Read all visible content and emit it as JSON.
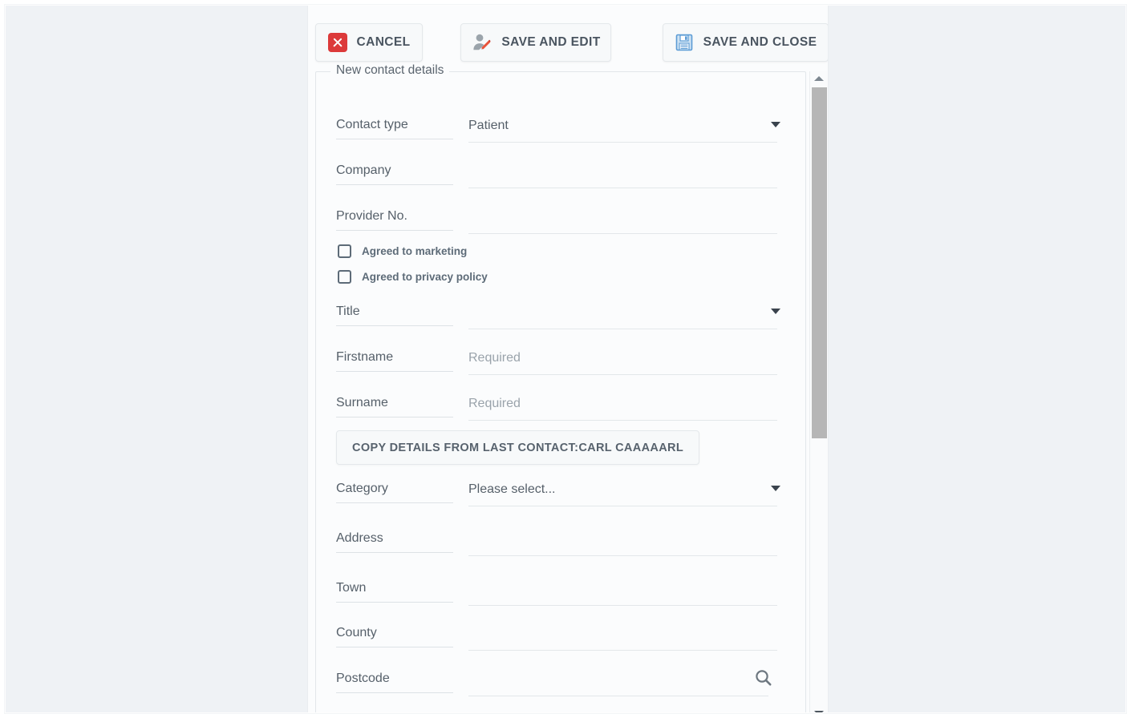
{
  "toolbar": {
    "cancel_label": "CANCEL",
    "save_and_edit_label": "SAVE AND EDIT",
    "save_and_close_label": "SAVE AND CLOSE"
  },
  "form": {
    "legend": "New contact details",
    "fields": [
      {
        "label": "Contact type",
        "value": "Patient",
        "placeholder": "",
        "type": "select"
      },
      {
        "label": "Company",
        "value": "",
        "placeholder": "",
        "type": "text"
      },
      {
        "label": "Provider No.",
        "value": "",
        "placeholder": "",
        "type": "text"
      },
      {
        "label": "Title",
        "value": "",
        "placeholder": "",
        "type": "select"
      },
      {
        "label": "Firstname",
        "value": "",
        "placeholder": "Required",
        "type": "text"
      },
      {
        "label": "Surname",
        "value": "",
        "placeholder": "Required",
        "type": "text"
      },
      {
        "label": "Category",
        "value": "Please select...",
        "placeholder": "",
        "type": "select"
      },
      {
        "label": "Address",
        "value": "",
        "placeholder": "",
        "type": "text"
      },
      {
        "label": "Town",
        "value": "",
        "placeholder": "",
        "type": "text"
      },
      {
        "label": "County",
        "value": "",
        "placeholder": "",
        "type": "text"
      },
      {
        "label": "Postcode",
        "value": "",
        "placeholder": "",
        "type": "text-with-search"
      }
    ],
    "checkboxes": [
      {
        "label": "Agreed to marketing",
        "checked": false
      },
      {
        "label": "Agreed to privacy policy",
        "checked": false
      }
    ],
    "copy_details_label": "COPY DETAILS FROM LAST CONTACT:CARL CAAAAARL"
  },
  "colors": {
    "page_background": "#eff2f5",
    "dialog_background": "#fbfcfd",
    "cancel_icon": "#dc3a3a",
    "save_icon": "#5b9bd5",
    "pencil_icon": "#e8533a",
    "label_text": "#56606a",
    "placeholder_text": "#9aa3ab",
    "scrollbar_thumb": "#b6b6b6"
  }
}
